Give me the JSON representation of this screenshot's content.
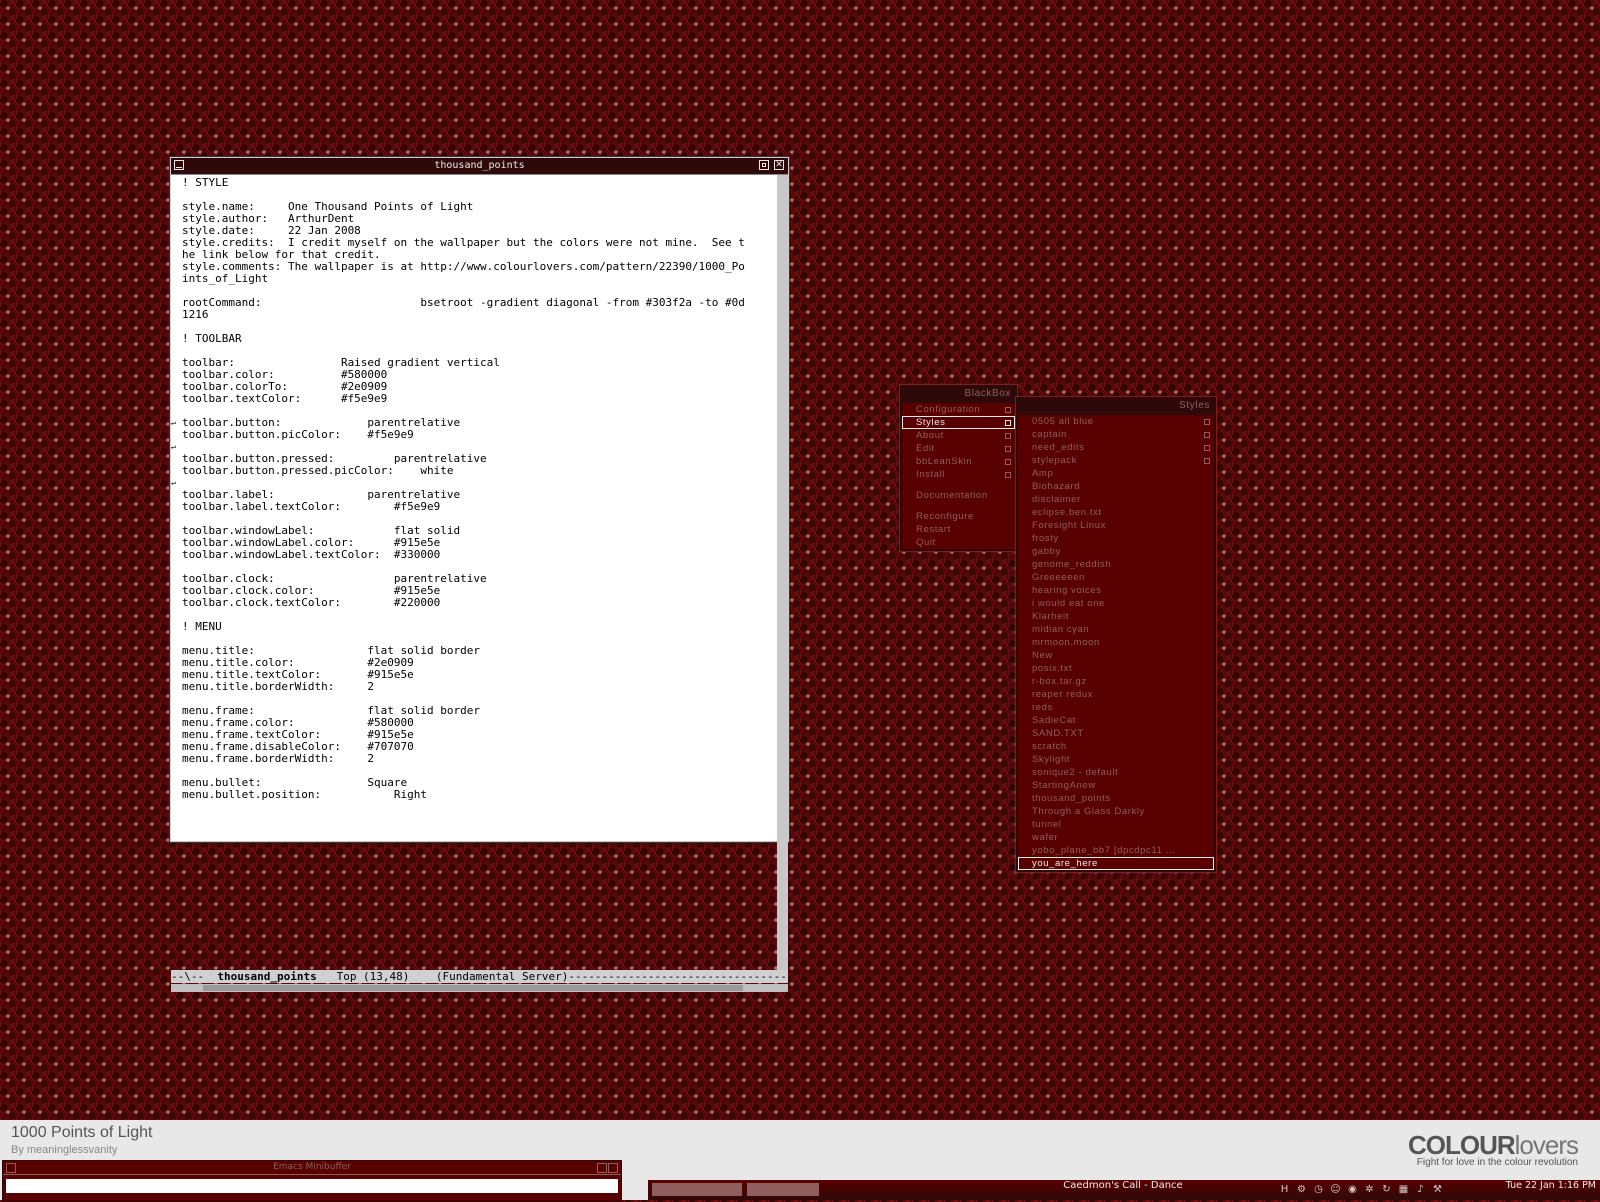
{
  "emacs": {
    "title": "thousand_points",
    "lines": [
      "! STYLE",
      "",
      "style.name:     One Thousand Points of Light",
      "style.author:   ArthurDent",
      "style.date:     22 Jan 2008",
      "style.credits:  I credit myself on the wallpaper but the colors were not mine.  See t",
      "he link below for that credit.",
      "style.comments: The wallpaper is at http://www.colourlovers.com/pattern/22390/1000_Po",
      "ints_of_Light",
      "",
      "rootCommand:                        bsetroot -gradient diagonal -from #303f2a -to #0d",
      "1216",
      "",
      "! TOOLBAR",
      "",
      "toolbar:                Raised gradient vertical",
      "toolbar.color:          #580000",
      "toolbar.colorTo:        #2e0909",
      "toolbar.textColor:      #f5e9e9",
      "",
      "toolbar.button:             parentrelative",
      "toolbar.button.picColor:    #f5e9e9",
      "",
      "toolbar.button.pressed:         parentrelative",
      "toolbar.button.pressed.picColor:    white",
      "",
      "toolbar.label:              parentrelative",
      "toolbar.label.textColor:        #f5e9e9",
      "",
      "toolbar.windowLabel:            flat solid",
      "toolbar.windowLabel.color:      #915e5e",
      "toolbar.windowLabel.textColor:  #330000",
      "",
      "toolbar.clock:                  parentrelative",
      "toolbar.clock.color:            #915e5e",
      "toolbar.clock.textColor:        #220000",
      "",
      "! MENU",
      "",
      "menu.title:                 flat solid border",
      "menu.title.color:           #2e0909",
      "menu.title.textColor:       #915e5e",
      "menu.title.borderWidth:     2",
      "",
      "menu.frame:                 flat solid border",
      "menu.frame.color:           #580000",
      "menu.frame.textColor:       #915e5e",
      "menu.frame.disableColor:    #707070",
      "menu.frame.borderWidth:     2",
      "",
      "menu.bullet:                Square",
      "menu.bullet.position:           Right"
    ],
    "modeline": {
      "prefix": "--\\--  ",
      "buffer": "thousand_points",
      "rest": "   Top (13,48)    (Fundamental Server)-----------------------------------------------"
    }
  },
  "blackbox_menu": {
    "title": "BlackBox",
    "items": [
      {
        "label": "Configuration",
        "submenu": true
      },
      {
        "label": "Styles",
        "submenu": true,
        "selected": true
      },
      {
        "label": "About",
        "submenu": true
      },
      {
        "label": "Edit",
        "submenu": true
      },
      {
        "label": "bbLeanSkin",
        "submenu": true
      },
      {
        "label": "Install",
        "submenu": true
      },
      {
        "gap": true
      },
      {
        "label": "Documentation"
      },
      {
        "gap": true
      },
      {
        "label": "Reconfigure"
      },
      {
        "label": "Restart"
      },
      {
        "label": "Quit"
      }
    ]
  },
  "styles_menu": {
    "title": "Styles",
    "items": [
      {
        "label": "0505 all blue",
        "submenu": true
      },
      {
        "label": "captain",
        "submenu": true
      },
      {
        "label": "need_edits",
        "submenu": true
      },
      {
        "label": "stylepack",
        "submenu": true
      },
      {
        "label": "Amp"
      },
      {
        "label": "Biohazard"
      },
      {
        "label": "disclaimer"
      },
      {
        "label": "eclipse.ben.txt"
      },
      {
        "label": "Foresight Linux"
      },
      {
        "label": "frosty"
      },
      {
        "label": "gabby"
      },
      {
        "label": "genome_reddish"
      },
      {
        "label": "Greeeeeen"
      },
      {
        "label": "hearing voices"
      },
      {
        "label": "i would eat one"
      },
      {
        "label": "Klarheit"
      },
      {
        "label": "midian cyan"
      },
      {
        "label": "mrmoon.moon"
      },
      {
        "label": "New"
      },
      {
        "label": "posix.txt"
      },
      {
        "label": "r-box.tar.gz"
      },
      {
        "label": "reaper redux"
      },
      {
        "label": "reds"
      },
      {
        "label": "SadieCat"
      },
      {
        "label": "SAND.TXT"
      },
      {
        "label": "scratch"
      },
      {
        "label": "Skylight"
      },
      {
        "label": "sonique2 - default"
      },
      {
        "label": "StartingAnew"
      },
      {
        "label": "thousand_points"
      },
      {
        "label": "Through a Glass Darkly"
      },
      {
        "label": "tunnel"
      },
      {
        "label": "wafer"
      },
      {
        "label": "yobo_plane_bb7 [dpcdpc11 ..."
      },
      {
        "label": "you_are_here",
        "selected": true
      }
    ]
  },
  "wallpaper_banner": {
    "title": "1000 Points of Light",
    "byline": "By meaninglessvanity",
    "logo_bold": "COLOUR",
    "logo_light": "lovers",
    "tagline": "Fight for love in the colour revolution"
  },
  "minibuffer": {
    "title": "Emacs Minibuffer"
  },
  "toolbar": {
    "window_label": "Caedmon's Call - Dance",
    "clock": "Tue 22 Jan 1:16 PM",
    "tray_icons": [
      "h-icon",
      "network-icon",
      "clock-icon",
      "user-icon",
      "disk-icon",
      "gear-icon",
      "refresh-icon",
      "chart-icon",
      "sound-icon",
      "settings-icon"
    ]
  },
  "colors": {
    "toolbar": "#580000",
    "toolbar_to": "#2e0909",
    "menu_title": "#2e0909",
    "menu_text": "#915e5e",
    "highlight_text": "#f5e9e9"
  }
}
